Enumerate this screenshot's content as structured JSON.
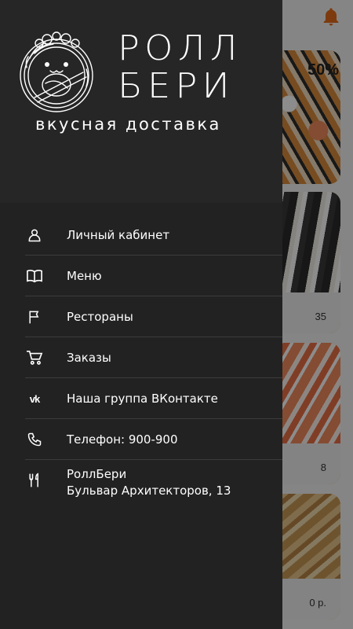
{
  "background": {
    "cards": [
      {
        "price": "",
        "badge": "50%"
      },
      {
        "price": "35"
      },
      {
        "price": "8"
      },
      {
        "price": "0 р."
      }
    ]
  },
  "drawer": {
    "brand": {
      "title_line1": "РОЛЛ",
      "title_line2": "БЕРИ",
      "subtitle": "вкусная доставка"
    },
    "menu": [
      {
        "icon": "person-icon",
        "label": "Личный кабинет"
      },
      {
        "icon": "book-icon",
        "label": "Меню"
      },
      {
        "icon": "flag-icon",
        "label": "Рестораны"
      },
      {
        "icon": "cart-icon",
        "label": "Заказы"
      },
      {
        "icon": "vk-icon",
        "label": "Наша группа ВКонтакте"
      },
      {
        "icon": "phone-icon",
        "label": "Телефон: 900-900"
      },
      {
        "icon": "restaurant-icon",
        "label_line1": "РоллБери",
        "label_line2": "Бульвар Архитекторов, 13"
      }
    ]
  },
  "colors": {
    "drawer_bg": "#222222",
    "header_bg": "#262626",
    "text": "#ffffff",
    "separator": "#3c3c3c",
    "card_accent": "#f0a53a"
  }
}
